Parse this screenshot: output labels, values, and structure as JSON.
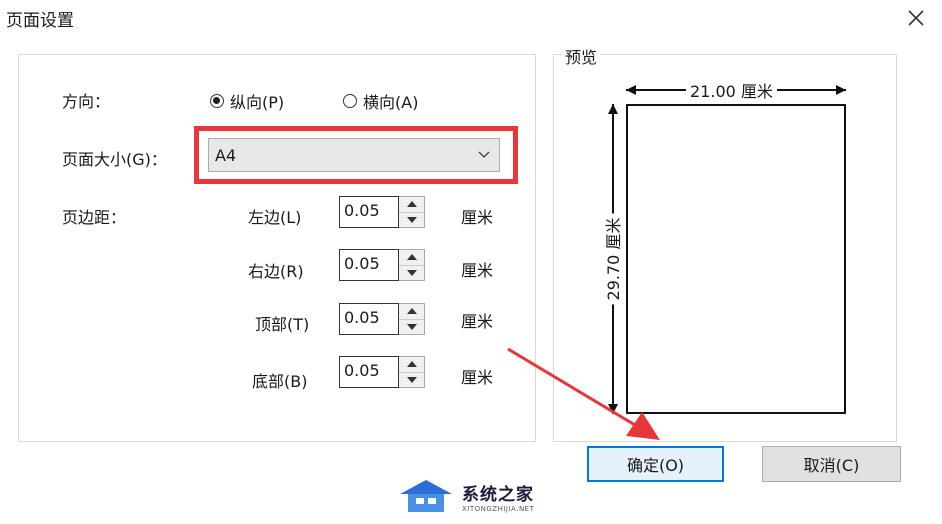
{
  "window": {
    "title": "页面设置",
    "close_icon": "close-icon"
  },
  "orientation": {
    "label": "方向：",
    "options": [
      {
        "label": "纵向(P)",
        "selected": true
      },
      {
        "label": "横向(A)",
        "selected": false
      }
    ]
  },
  "page_size": {
    "label": "页面大小(G)：",
    "value": "A4",
    "highlight_color": "#e8373a"
  },
  "margins": {
    "label": "页边距：",
    "unit": "厘米",
    "items": [
      {
        "label": "左边(L)",
        "value": "0.05"
      },
      {
        "label": "右边(R)",
        "value": "0.05"
      },
      {
        "label": "顶部(T)",
        "value": "0.05"
      },
      {
        "label": "底部(B)",
        "value": "0.05"
      }
    ]
  },
  "preview": {
    "legend": "预览",
    "width_label": "21.00 厘米",
    "height_label": "29.70 厘米"
  },
  "buttons": {
    "ok": "确定(O)",
    "cancel": "取消(C)"
  },
  "accent_color": "#0078d7",
  "watermark": {
    "main": "系统之家",
    "sub": "XITONGZHIJIA.NET"
  }
}
